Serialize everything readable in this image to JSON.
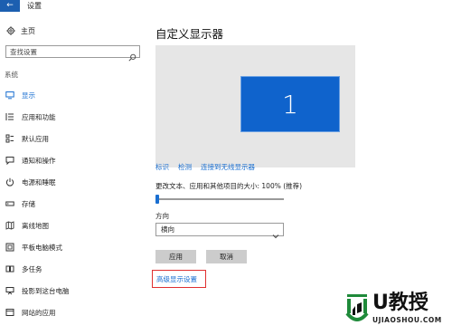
{
  "window": {
    "back_glyph": "←",
    "title": "设置"
  },
  "sidebar": {
    "home_label": "主页",
    "search_placeholder": "查找设置",
    "section_label": "系统",
    "items": [
      {
        "label": "显示",
        "icon": "monitor-icon",
        "active": true
      },
      {
        "label": "应用和功能",
        "icon": "apps-list-icon",
        "active": false
      },
      {
        "label": "默认应用",
        "icon": "default-apps-icon",
        "active": false
      },
      {
        "label": "通知和操作",
        "icon": "notification-icon",
        "active": false
      },
      {
        "label": "电源和睡眠",
        "icon": "power-icon",
        "active": false
      },
      {
        "label": "存储",
        "icon": "storage-icon",
        "active": false
      },
      {
        "label": "离线地图",
        "icon": "map-icon",
        "active": false
      },
      {
        "label": "平板电脑模式",
        "icon": "tablet-icon",
        "active": false
      },
      {
        "label": "多任务",
        "icon": "multitask-icon",
        "active": false
      },
      {
        "label": "投影到这台电脑",
        "icon": "project-icon",
        "active": false
      },
      {
        "label": "网站的应用",
        "icon": "web-apps-icon",
        "active": false
      }
    ]
  },
  "main": {
    "title": "自定义显示器",
    "monitor_number": "1",
    "links": [
      "标识",
      "检测",
      "连接到无线显示器"
    ],
    "scale_label": "更改文本、应用和其他项目的大小: 100% (推荐)",
    "scale_value": 0,
    "orientation_label": "方向",
    "orientation_value": "横向",
    "apply_label": "应用",
    "cancel_label": "取消",
    "advanced_link": "高级显示设置"
  },
  "watermark": {
    "brand": "U教授",
    "domain": "UJIAOSHOU.COM"
  },
  "colors": {
    "accent": "#1a6fd1",
    "back_button": "#1c5fb0",
    "monitor_fill": "#0f63cc",
    "preview_bg": "#e6e6e6",
    "button_bg": "#cccccc",
    "highlight_border": "#e03030",
    "logo_green": "#1f8a3a"
  }
}
